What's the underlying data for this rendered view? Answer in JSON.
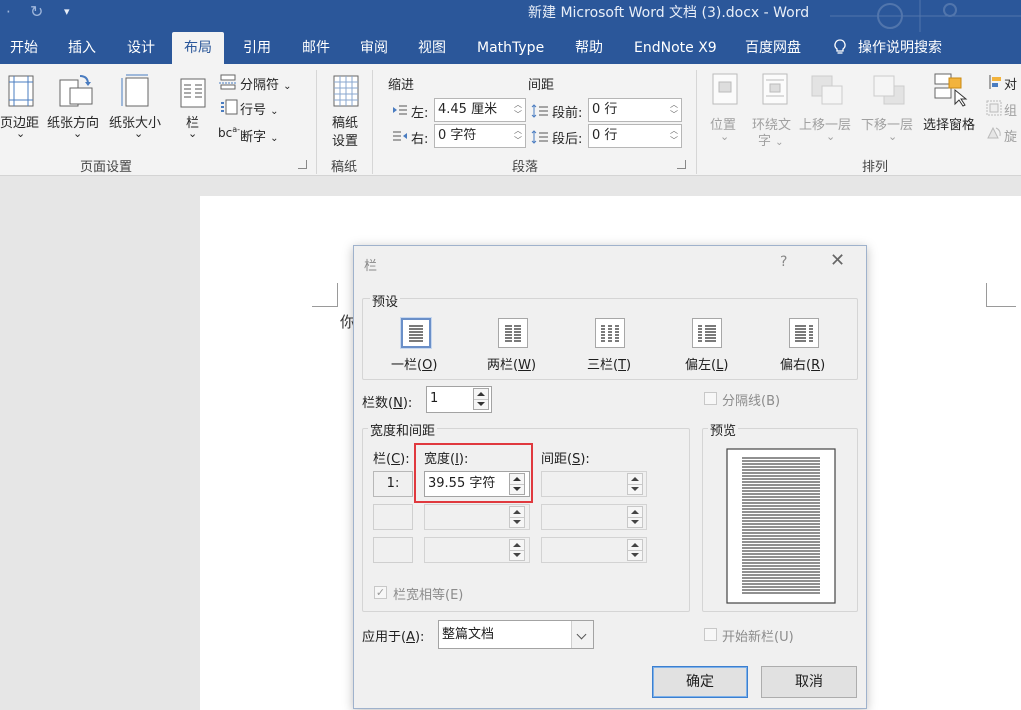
{
  "titlebar": {
    "undo_glyph": "·",
    "redo_glyph": "↻",
    "qa_menu_glyph": "≡",
    "title": "新建 Microsoft Word 文档 (3).docx  -  Word"
  },
  "tabs": [
    "开始",
    "插入",
    "设计",
    "布局",
    "引用",
    "邮件",
    "审阅",
    "视图",
    "MathType",
    "帮助",
    "EndNote X9",
    "百度网盘",
    "操作说明搜索"
  ],
  "ribbon": {
    "page_setup": {
      "margins": "页边距",
      "orientation": "纸张方向",
      "size": "纸张大小",
      "columns": "栏",
      "breaks": "分隔符",
      "line_numbers": "行号",
      "hyphenation": "断字",
      "caret": "⌄",
      "group_label": "页面设置"
    },
    "manuscript": {
      "line1": "稿纸",
      "line2": "设置",
      "group_label": "稿纸"
    },
    "paragraph": {
      "indent_header": "缩进",
      "spacing_header": "间距",
      "left_label": "左:",
      "left_value": "4.45 厘米",
      "right_label": "右:",
      "right_value": "0 字符",
      "before_label": "段前:",
      "before_value": "0 行",
      "after_label": "段后:",
      "after_value": "0 行",
      "group_label": "段落"
    },
    "arrange": {
      "position": "位置",
      "wrap_line1": "环绕文",
      "wrap_line2": "字",
      "forward": "上移一层",
      "backward": "下移一层",
      "selection_pane": "选择窗格",
      "align": "对",
      "group": "组",
      "rotate": "旋",
      "group_label": "排列"
    }
  },
  "document": {
    "text": "你"
  },
  "dialog": {
    "title": "栏",
    "help": "?",
    "close": "✕",
    "presets_label": "预设",
    "presets": [
      {
        "pre": "一栏(",
        "key": "O",
        "post": ")"
      },
      {
        "pre": "两栏(",
        "key": "W",
        "post": ")"
      },
      {
        "pre": "三栏(",
        "key": "T",
        "post": ")"
      },
      {
        "pre": "偏左(",
        "key": "L",
        "post": ")"
      },
      {
        "pre": "偏右(",
        "key": "R",
        "post": ")"
      }
    ],
    "num_cols_label": {
      "pre": "栏数(",
      "key": "N",
      "post": "):"
    },
    "num_cols_value": "1",
    "line_between": "分隔线(B)",
    "width_spacing_label": "宽度和间距",
    "col_header": {
      "pre": "栏(",
      "key": "C",
      "post": "):"
    },
    "width_header": {
      "pre": "宽度(",
      "key": "I",
      "post": "):"
    },
    "spacing_header": {
      "pre": "间距(",
      "key": "S",
      "post": "):"
    },
    "rows": [
      {
        "col": "1:",
        "width": "39.55 字符",
        "spacing": ""
      },
      {
        "col": "",
        "width": "",
        "spacing": ""
      },
      {
        "col": "",
        "width": "",
        "spacing": ""
      }
    ],
    "equal_width": "栏宽相等(E)",
    "preview_label": "预览",
    "apply_label": {
      "pre": "应用于(",
      "key": "A",
      "post": "):"
    },
    "apply_value": "整篇文档",
    "new_column": "开始新栏(U)",
    "ok": "确定",
    "cancel": "取消",
    "check_mark": "✓"
  },
  "colors": {
    "titlebar": "#2b579a",
    "ribbon": "#f3f3f3",
    "highlight": "#e0393e",
    "default_button_border": "#3c7fcf"
  }
}
